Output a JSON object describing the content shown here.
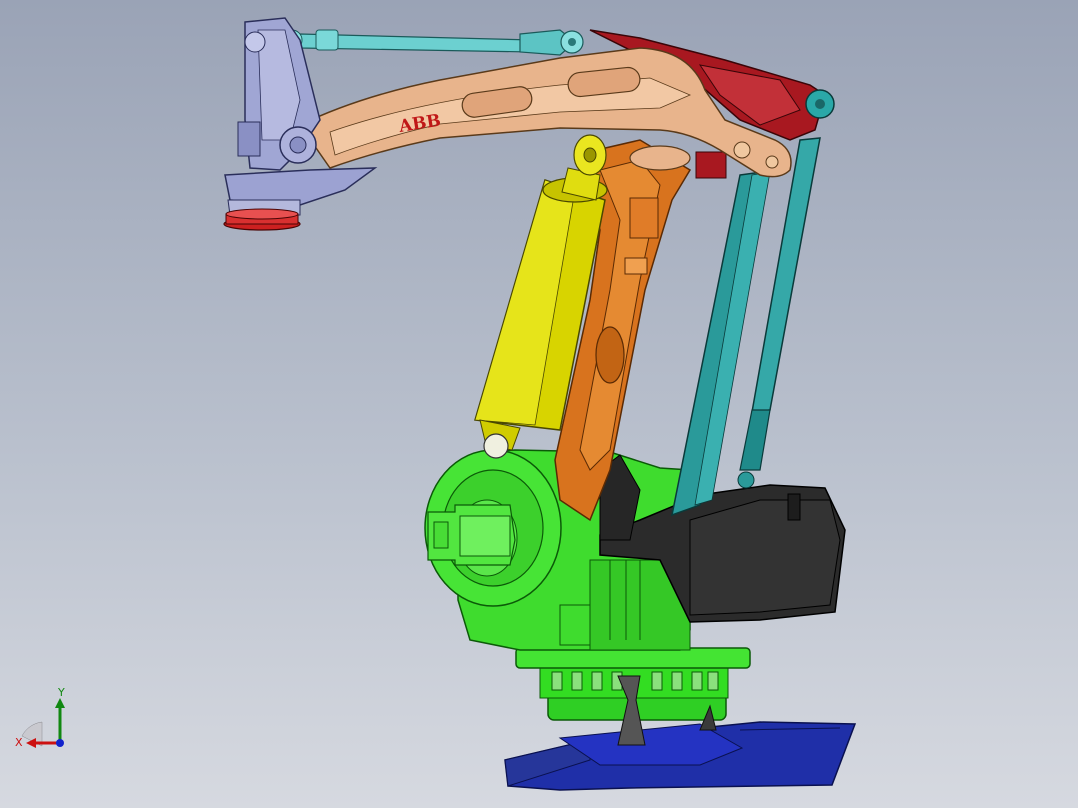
{
  "brand": {
    "logo_text": "ABB"
  },
  "triad": {
    "x_label": "X",
    "y_label": "Y",
    "x_color": "#cc1111",
    "y_color": "#118811",
    "z_color": "#1122cc"
  },
  "colors": {
    "background_top": "#9aa3b6",
    "background_bottom": "#d6d9e0",
    "base": "#1f2fa8",
    "turntable": "#33dd22",
    "frame": "#44dd33",
    "lower_arm": "#d2701c",
    "cylinder": "#d8d400",
    "upper_arm": "#e8b48c",
    "rear_link": "#a81820",
    "rods": "#2a9a9a",
    "counterweight": "#2a2a2a",
    "wrist": "#9aa0cc",
    "tool_flange": "#cc2020"
  }
}
